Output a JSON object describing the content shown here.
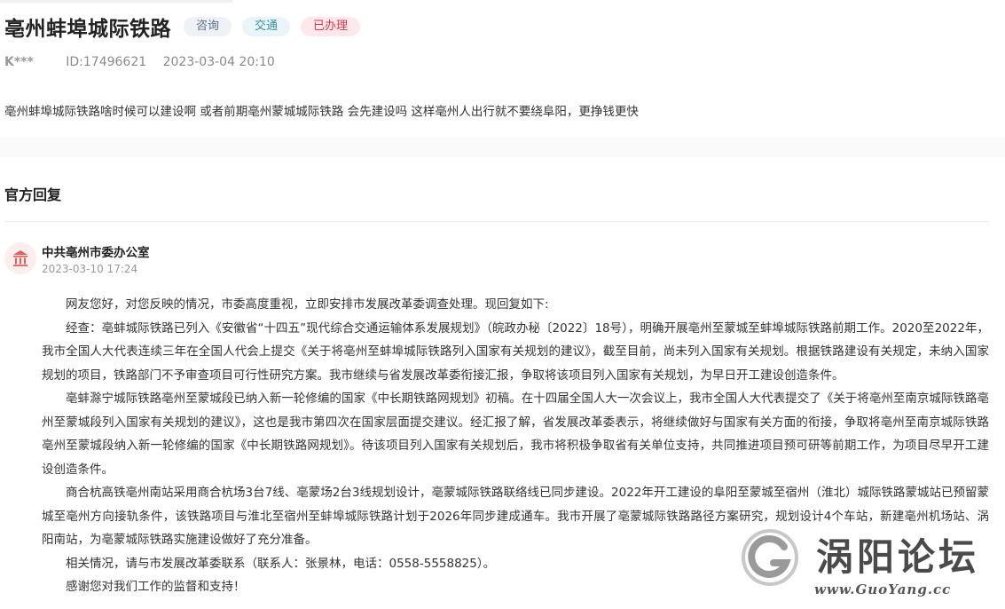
{
  "header": {
    "title": "亳州蚌埠城际铁路",
    "tags": [
      "咨询",
      "交通",
      "已办理"
    ]
  },
  "meta": {
    "user": "K***",
    "id": "ID:17496621",
    "time": "2023-03-04 20:10"
  },
  "question": "亳州蚌埠城际铁路啥时候可以建设啊 或者前期亳州蒙城城际铁路 会先建设吗 这样亳州人出行就不要绕阜阳，更挣钱更快",
  "reply_section": {
    "title": "官方回复",
    "org": "中共亳州市委办公室",
    "time": "2023-03-10 17:24",
    "paragraphs": [
      "网友您好，对您反映的情况，市委高度重视，立即安排市发展改革委调查处理。现回复如下:",
      "经查：亳蚌城际铁路已列入《安徽省“十四五”现代综合交通运输体系发展规划》（皖政办秘〔2022〕18号），明确开展亳州至蒙城至蚌埠城际铁路前期工作。2020至2022年，我市全国人大代表连续三年在全国人代会上提交《关于将亳州至蚌埠城际铁路列入国家有关规划的建议》，截至目前，尚未列入国家有关规划。根据铁路建设有关规定，未纳入国家规划的项目，铁路部门不予审查项目可行性研究方案。我市继续与省发展改革委衔接汇报，争取将该项目列入国家有关规划，为早日开工建设创造条件。",
      "亳蚌滁宁城际铁路亳州至蒙城段已纳入新一轮修编的国家《中长期铁路网规划》初稿。在十四届全国人大一次会议上，我市全国人大代表提交了《关于将亳州至南京城际铁路亳州至蒙城段列入国家有关规划的建议》，这也是我市第四次在国家层面提交建议。经汇报了解，省发展改革委表示，将继续做好与国家有关方面的衔接，争取将亳州至南京城际铁路亳州至蒙城段纳入新一轮修编的国家《中长期铁路网规划》。待该项目列入国家有关规划后，我市将积极争取省有关单位支持，共同推进项目预可研等前期工作，为项目尽早开工建设创造条件。",
      "商合杭高铁亳州南站采用商合杭场3台7线、亳蒙场2台3线规划设计，亳蒙城际铁路联络线已同步建设。2022年开工建设的阜阳至蒙城至宿州（淮北）城际铁路蒙城站已预留蒙城至亳州方向接轨条件，该铁路项目与淮北至宿州至蚌埠城际铁路计划于2026年同步建成通车。我市开展了亳蒙城际铁路路径方案研究，规划设计4个车站，新建亳州机场站、涡阳南站，为亳蒙城际铁路实施建设做好了充分准备。",
      "相关情况，请与市发展改革委联系（联系人：张景林，电话：0558-5558825）。",
      "感谢您对我们工作的监督和支持！"
    ]
  },
  "watermark": {
    "name": "涡阳论坛",
    "url": "www.GuoYang.cc"
  },
  "icons": {
    "avatar": "government-building-icon"
  }
}
